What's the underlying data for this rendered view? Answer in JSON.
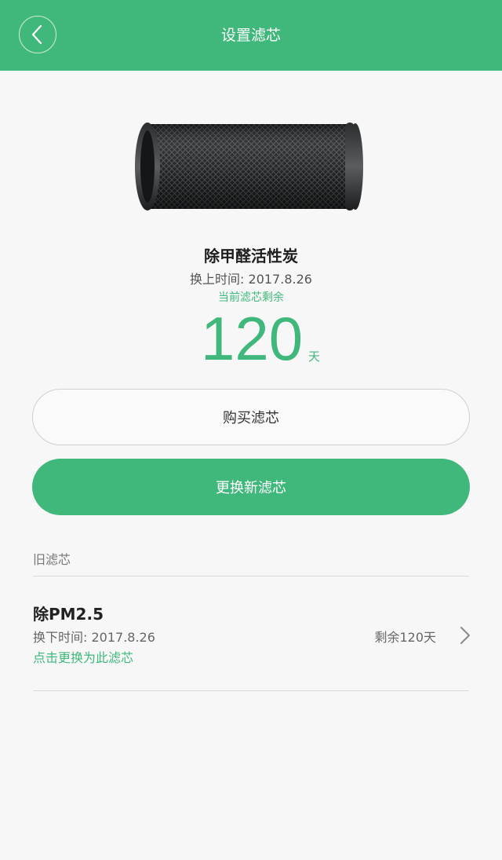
{
  "header": {
    "title": "设置滤芯",
    "back_icon": "chevron-left-icon"
  },
  "current_filter": {
    "image": "filter-cartridge-image",
    "name": "除甲醛活性炭",
    "installed_time": "换上时间: 2017.8.26",
    "remaining_label": "当前滤芯剩余",
    "remaining_days": "120",
    "unit": "天"
  },
  "buttons": {
    "buy": "购买滤芯",
    "replace": "更换新滤芯"
  },
  "old_filters": {
    "section_title": "旧滤芯",
    "items": [
      {
        "name": "除PM2.5",
        "removed_time": "换下时间: 2017.8.26",
        "action": "点击更换为此滤芯",
        "remaining": "剩余120天",
        "chevron_icon": "chevron-right-icon"
      }
    ]
  },
  "colors": {
    "accent": "#40b87c",
    "background": "#f7f7f7"
  }
}
